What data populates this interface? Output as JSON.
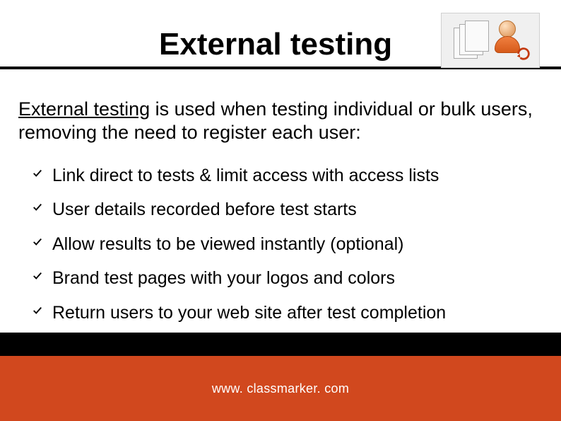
{
  "header": {
    "title": "External testing",
    "icon_docs_name": "documents-icon",
    "icon_user_name": "user-arrow-icon"
  },
  "intro": {
    "emphasis": "External testing",
    "rest": " is used when testing individual or bulk users, removing the need to register each user:"
  },
  "bullets": [
    "Link direct to tests & limit access with access lists",
    "User details recorded before test starts",
    "Allow results to be viewed instantly (optional)",
    "Brand test pages with your logos and colors",
    "Return users to your web site after test completion"
  ],
  "footer": {
    "url": "www. classmarker. com"
  },
  "colors": {
    "accent": "#d1481e",
    "black": "#000000"
  }
}
